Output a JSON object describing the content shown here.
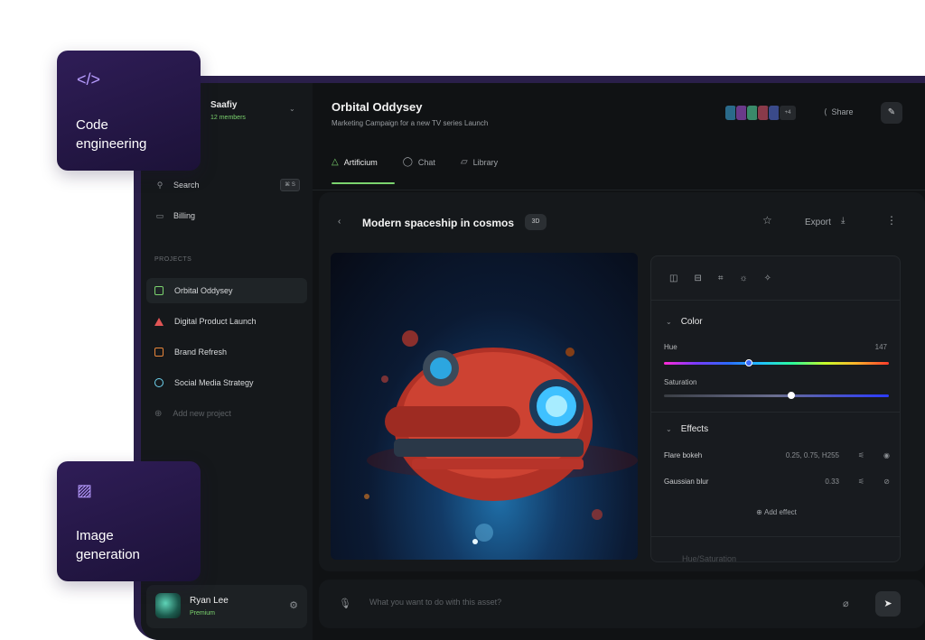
{
  "workspace": {
    "name": "Saafiy",
    "members": "12 members"
  },
  "nav": {
    "search_label": "Search",
    "search_shortcut": "⌘ S",
    "billing_label": "Billing"
  },
  "projects": {
    "heading": "PROJECTS",
    "items": [
      {
        "label": "Orbital Oddysey",
        "color": "#7bd36e",
        "shape": "square",
        "active": true
      },
      {
        "label": "Digital Product Launch",
        "color": "#e05555",
        "shape": "triangle"
      },
      {
        "label": "Brand Refresh",
        "color": "#e8853a",
        "shape": "square"
      },
      {
        "label": "Social Media Strategy",
        "color": "#6fd4f0",
        "shape": "circle"
      }
    ],
    "add_label": "Add new project"
  },
  "user": {
    "name": "Ryan Lee",
    "plan": "Premium"
  },
  "header": {
    "title": "Orbital Oddysey",
    "subtitle": "Marketing Campaign for a new TV series Launch",
    "collaborators_more": "+4",
    "share_label": "Share"
  },
  "tabs": [
    {
      "label": "Artificium",
      "icon": "triangle-icon",
      "active": true
    },
    {
      "label": "Chat",
      "icon": "chat-bubble-icon"
    },
    {
      "label": "Library",
      "icon": "folder-icon"
    }
  ],
  "asset": {
    "title": "Modern spaceship in cosmos",
    "badge": "3D",
    "export_label": "Export"
  },
  "panel": {
    "color_heading": "Color",
    "hue_label": "Hue",
    "hue_value": "147",
    "hue_fraction": 0.38,
    "saturation_label": "Saturation",
    "saturation_fraction": 0.57,
    "effects_heading": "Effects",
    "effects": [
      {
        "name": "Flare bokeh",
        "value": "0.25, 0.75, H255",
        "visible": true
      },
      {
        "name": "Gaussian blur",
        "value": "0.33",
        "visible": false
      }
    ],
    "add_effect_label": "Add effect",
    "next_section": "Hue/Saturation"
  },
  "prompt": {
    "placeholder": "What you want to do with this asset?"
  },
  "feature_cards": [
    {
      "label_line1": "Code",
      "label_line2": "engineering",
      "icon": "code-icon"
    },
    {
      "label_line1": "Image",
      "label_line2": "generation",
      "icon": "image-icon"
    }
  ],
  "colors": {
    "accent": "#7bd36e",
    "card_purple": "#2f1d57"
  }
}
